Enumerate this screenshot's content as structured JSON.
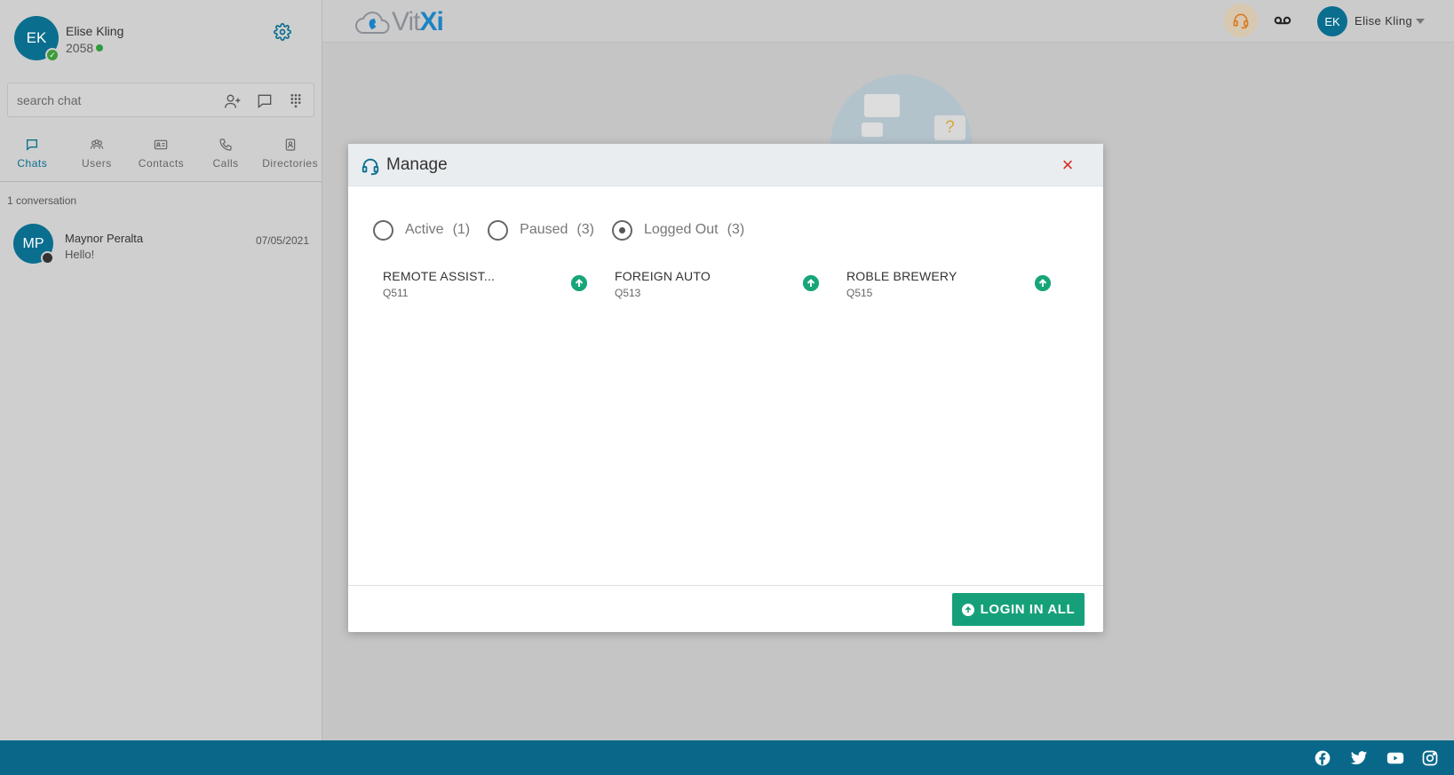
{
  "sidebar": {
    "profile": {
      "initials": "EK",
      "name": "Elise Kling",
      "extension": "2058"
    },
    "search": {
      "placeholder": "search chat"
    },
    "tabs": [
      {
        "label": "Chats",
        "icon": "chat-icon",
        "active": true
      },
      {
        "label": "Users",
        "icon": "users-icon",
        "active": false
      },
      {
        "label": "Contacts",
        "icon": "contact-card-icon",
        "active": false
      },
      {
        "label": "Calls",
        "icon": "phone-icon",
        "active": false
      },
      {
        "label": "Directories",
        "icon": "directory-icon",
        "active": false
      }
    ],
    "conversation_count": "1 conversation",
    "conversations": [
      {
        "initials": "MP",
        "name": "Maynor Peralta",
        "message": "Hello!",
        "date": "07/05/2021"
      }
    ]
  },
  "topbar": {
    "logo_a": "Vit",
    "logo_b": "Xi",
    "user_initials": "EK",
    "user_name": "Elise Kling"
  },
  "modal": {
    "title": "Manage",
    "close": "×",
    "filters": [
      {
        "label": "Active",
        "count": "(1)",
        "checked": false
      },
      {
        "label": "Paused",
        "count": "(3)",
        "checked": false
      },
      {
        "label": "Logged Out",
        "count": "(3)",
        "checked": true
      }
    ],
    "queues": [
      {
        "name": "REMOTE ASSIST...",
        "id": "Q511"
      },
      {
        "name": "FOREIGN AUTO",
        "id": "Q513"
      },
      {
        "name": "ROBLE BREWERY",
        "id": "Q515"
      }
    ],
    "login_all_label": "LOGIN IN ALL"
  },
  "illustration": {
    "symbol": "?"
  },
  "colors": {
    "primary": "#0a6e8f",
    "success": "#16a07a",
    "close": "#d9271d",
    "footer": "#09688a"
  }
}
